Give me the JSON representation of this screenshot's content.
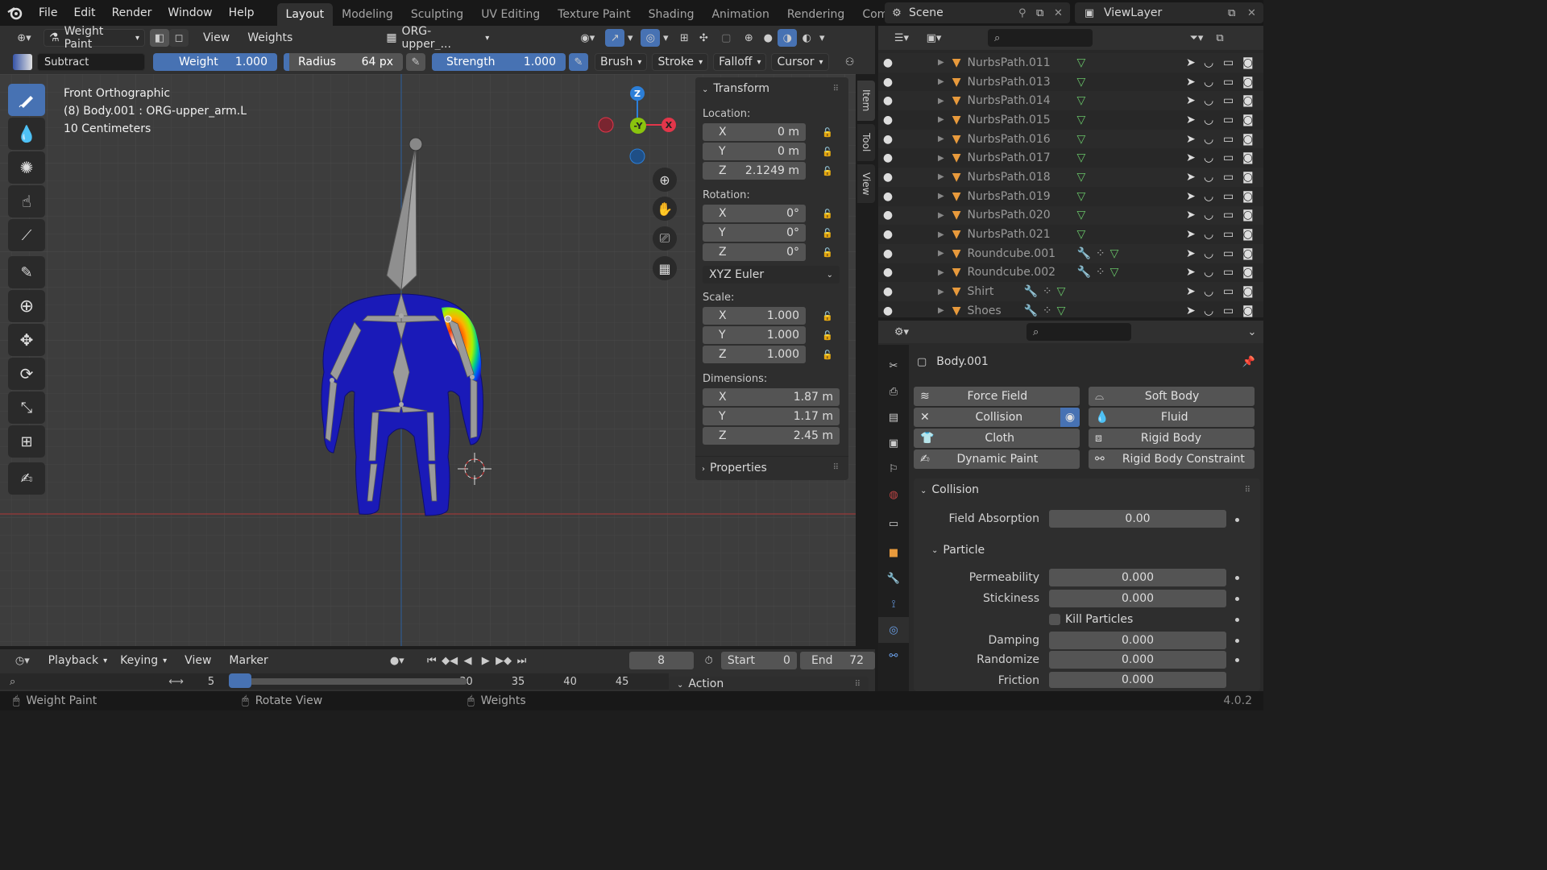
{
  "topbar": {
    "menus": [
      "File",
      "Edit",
      "Render",
      "Window",
      "Help"
    ],
    "workspaces": [
      "Layout",
      "Modeling",
      "Sculpting",
      "UV Editing",
      "Texture Paint",
      "Shading",
      "Animation",
      "Rendering",
      "Compositin"
    ],
    "active_workspace": "Layout",
    "scene": "Scene",
    "view_layer": "ViewLayer"
  },
  "viewport_header": {
    "mode": "Weight Paint",
    "menus": [
      "View",
      "Weights"
    ],
    "vertex_group": "ORG-upper_..."
  },
  "tool_header": {
    "blend": "Subtract",
    "weight_label": "Weight",
    "weight_value": "1.000",
    "radius_label": "Radius",
    "radius_value": "64 px",
    "strength_label": "Strength",
    "strength_value": "1.000",
    "menus": [
      "Brush",
      "Stroke",
      "Falloff",
      "Cursor"
    ]
  },
  "viewport": {
    "view_name": "Front Orthographic",
    "object_info": "(8) Body.001 : ORG-upper_arm.L",
    "scale_info": "10 Centimeters",
    "gizmo": {
      "z": "Z",
      "y": "-Y",
      "x": "X"
    }
  },
  "npanel": {
    "tabs": [
      "Item",
      "Tool",
      "View"
    ],
    "transform_title": "Transform",
    "location_label": "Location:",
    "location": [
      {
        "axis": "X",
        "value": "0 m"
      },
      {
        "axis": "Y",
        "value": "0 m"
      },
      {
        "axis": "Z",
        "value": "2.1249 m"
      }
    ],
    "rotation_label": "Rotation:",
    "rotation": [
      {
        "axis": "X",
        "value": "0°"
      },
      {
        "axis": "Y",
        "value": "0°"
      },
      {
        "axis": "Z",
        "value": "0°"
      }
    ],
    "rotation_mode": "XYZ Euler",
    "scale_label": "Scale:",
    "scale": [
      {
        "axis": "X",
        "value": "1.000"
      },
      {
        "axis": "Y",
        "value": "1.000"
      },
      {
        "axis": "Z",
        "value": "1.000"
      }
    ],
    "dimensions_label": "Dimensions:",
    "dimensions": [
      {
        "axis": "X",
        "value": "1.87 m"
      },
      {
        "axis": "Y",
        "value": "1.17 m"
      },
      {
        "axis": "Z",
        "value": "2.45 m"
      }
    ],
    "properties_title": "Properties"
  },
  "outliner": {
    "items": [
      "NurbsPath.011",
      "NurbsPath.013",
      "NurbsPath.014",
      "NurbsPath.015",
      "NurbsPath.016",
      "NurbsPath.017",
      "NurbsPath.018",
      "NurbsPath.019",
      "NurbsPath.020",
      "NurbsPath.021",
      "Roundcube.001",
      "Roundcube.002",
      "Shirt",
      "Shoes"
    ]
  },
  "properties": {
    "object_name": "Body.001",
    "physics_buttons": {
      "force_field": "Force Field",
      "soft_body": "Soft Body",
      "collision": "Collision",
      "fluid": "Fluid",
      "cloth": "Cloth",
      "rigid_body": "Rigid Body",
      "dynamic_paint": "Dynamic Paint",
      "rigid_body_constraint": "Rigid Body Constraint"
    },
    "collision_title": "Collision",
    "field_absorption_label": "Field Absorption",
    "field_absorption": "0.00",
    "particle_title": "Particle",
    "permeability_label": "Permeability",
    "permeability": "0.000",
    "stickiness_label": "Stickiness",
    "stickiness": "0.000",
    "kill_particles_label": "Kill Particles",
    "damping_label": "Damping",
    "damping": "0.000",
    "randomize_label": "Randomize",
    "randomize": "0.000",
    "friction_label": "Friction",
    "friction": "0.000"
  },
  "timeline": {
    "menus": [
      "Playback",
      "Keying",
      "View",
      "Marker"
    ],
    "current_frame": "8",
    "start_label": "Start",
    "start": "0",
    "end_label": "End",
    "end": "72",
    "ruler": [
      "5",
      "30",
      "35",
      "40",
      "45"
    ],
    "action_label": "Action"
  },
  "statusbar": {
    "left": "Weight Paint",
    "middle": "Rotate View",
    "right": "Weights",
    "version": "4.0.2"
  },
  "colors": {
    "accent": "#4772b3",
    "mesh": "#1a1ab8",
    "axis_x": "#e2364a",
    "axis_y": "#8ac40e",
    "axis_z": "#2c7fd8"
  }
}
